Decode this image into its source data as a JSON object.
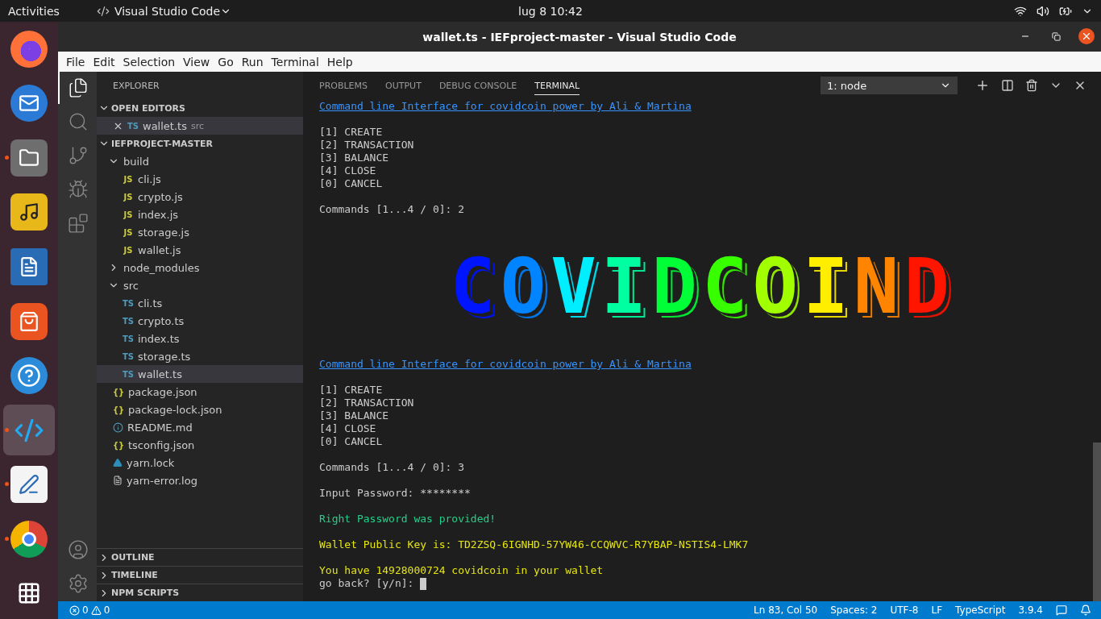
{
  "top_bar": {
    "activities": "Activities",
    "app_menu": "Visual Studio Code",
    "clock": "lug 8  10:42"
  },
  "dock": [
    {
      "kind": "firefox",
      "running": false,
      "selected": false
    },
    {
      "kind": "mail",
      "running": false,
      "selected": false
    },
    {
      "kind": "files",
      "running": true,
      "selected": false
    },
    {
      "kind": "music",
      "running": false,
      "selected": false
    },
    {
      "kind": "writer",
      "running": false,
      "selected": false
    },
    {
      "kind": "store",
      "running": false,
      "selected": false
    },
    {
      "kind": "help",
      "running": false,
      "selected": false
    },
    {
      "kind": "vscode",
      "running": true,
      "selected": true
    },
    {
      "kind": "editor",
      "running": true,
      "selected": false
    },
    {
      "kind": "chrome",
      "running": true,
      "selected": false
    },
    {
      "kind": "apps",
      "running": false,
      "selected": false
    }
  ],
  "window": {
    "title": "wallet.ts - IEFproject-master - Visual Studio Code"
  },
  "menu": [
    "File",
    "Edit",
    "Selection",
    "View",
    "Go",
    "Run",
    "Terminal",
    "Help"
  ],
  "activity_bar": [
    {
      "kind": "files",
      "selected": true
    },
    {
      "kind": "search",
      "selected": false
    },
    {
      "kind": "git",
      "selected": false
    },
    {
      "kind": "debug",
      "selected": false
    },
    {
      "kind": "extensions",
      "selected": false
    }
  ],
  "sidebar": {
    "title": "EXPLORER",
    "open_editors": {
      "title": "OPEN EDITORS",
      "expanded": true,
      "items": [
        {
          "name": "wallet.ts",
          "folder": "src",
          "kind": "ts",
          "badge": "TS",
          "selected": true
        }
      ]
    },
    "project": {
      "title": "IEFPROJECT-MASTER",
      "expanded": true,
      "items": [
        {
          "name": "build",
          "kind": "folder",
          "expanded": true,
          "selected": false,
          "children": [
            {
              "name": "cli.js",
              "kind": "js",
              "badge": "JS",
              "selected": false
            },
            {
              "name": "crypto.js",
              "kind": "js",
              "badge": "JS",
              "selected": false
            },
            {
              "name": "index.js",
              "kind": "js",
              "badge": "JS",
              "selected": false
            },
            {
              "name": "storage.js",
              "kind": "js",
              "badge": "JS",
              "selected": false
            },
            {
              "name": "wallet.js",
              "kind": "js",
              "badge": "JS",
              "selected": false
            }
          ]
        },
        {
          "name": "node_modules",
          "kind": "folder",
          "expanded": false,
          "selected": false
        },
        {
          "name": "src",
          "kind": "folder",
          "expanded": true,
          "selected": false,
          "children": [
            {
              "name": "cli.ts",
              "kind": "ts",
              "badge": "TS",
              "selected": false
            },
            {
              "name": "crypto.ts",
              "kind": "ts",
              "badge": "TS",
              "selected": false
            },
            {
              "name": "index.ts",
              "kind": "ts",
              "badge": "TS",
              "selected": false
            },
            {
              "name": "storage.ts",
              "kind": "ts",
              "badge": "TS",
              "selected": false
            },
            {
              "name": "wallet.ts",
              "kind": "ts",
              "badge": "TS",
              "selected": true
            }
          ]
        },
        {
          "name": "package.json",
          "kind": "json",
          "badge": "{}",
          "selected": false
        },
        {
          "name": "package-lock.json",
          "kind": "json",
          "badge": "{}",
          "selected": false
        },
        {
          "name": "README.md",
          "kind": "info",
          "selected": false
        },
        {
          "name": "tsconfig.json",
          "kind": "json",
          "badge": "{}",
          "selected": false
        },
        {
          "name": "yarn.lock",
          "kind": "yarn",
          "selected": false
        },
        {
          "name": "yarn-error.log",
          "kind": "log",
          "selected": false
        }
      ]
    },
    "sections": [
      {
        "title": "OUTLINE",
        "expanded": false
      },
      {
        "title": "TIMELINE",
        "expanded": false
      },
      {
        "title": "NPM SCRIPTS",
        "expanded": false
      }
    ]
  },
  "panel": {
    "tabs": [
      {
        "label": "PROBLEMS",
        "selected": false
      },
      {
        "label": "OUTPUT",
        "selected": false
      },
      {
        "label": "DEBUG CONSOLE",
        "selected": false
      },
      {
        "label": "TERMINAL",
        "selected": true
      }
    ],
    "terminal_select": "1: node",
    "terminal": [
      {
        "kind": "link",
        "text": "Command line Interface for covidcoin power by Ali & Martina"
      },
      {
        "kind": "blank"
      },
      {
        "kind": "plain",
        "text": "[1] CREATE"
      },
      {
        "kind": "plain",
        "text": "[2] TRANSACTION"
      },
      {
        "kind": "plain",
        "text": "[3] BALANCE"
      },
      {
        "kind": "plain",
        "text": "[4] CLOSE"
      },
      {
        "kind": "plain",
        "text": "[0] CANCEL"
      },
      {
        "kind": "blank"
      },
      {
        "kind": "plain",
        "text": "Commands [1...4 / 0]: 2"
      },
      {
        "kind": "banner",
        "text": "COVIDCOIND"
      },
      {
        "kind": "link",
        "text": "Command line Interface for covidcoin power by Ali & Martina"
      },
      {
        "kind": "blank"
      },
      {
        "kind": "plain",
        "text": "[1] CREATE"
      },
      {
        "kind": "plain",
        "text": "[2] TRANSACTION"
      },
      {
        "kind": "plain",
        "text": "[3] BALANCE"
      },
      {
        "kind": "plain",
        "text": "[4] CLOSE"
      },
      {
        "kind": "plain",
        "text": "[0] CANCEL"
      },
      {
        "kind": "blank"
      },
      {
        "kind": "plain",
        "text": "Commands [1...4 / 0]: 3"
      },
      {
        "kind": "blank"
      },
      {
        "kind": "plain",
        "text": "Input Password: ********"
      },
      {
        "kind": "blank"
      },
      {
        "kind": "green",
        "text": "Right Password was provided!"
      },
      {
        "kind": "blank"
      },
      {
        "kind": "yellow",
        "text": "Wallet Public Key is: TD2ZSQ-6IGNHD-57YW46-CCQWVC-R7YBAP-NSTIS4-LMK7"
      },
      {
        "kind": "blank"
      },
      {
        "kind": "yellow",
        "text": "You have 14928000724 covidcoin in your wallet"
      },
      {
        "kind": "prompt",
        "text": "go back? [y/n]:"
      }
    ]
  },
  "status_bar": {
    "errors": "0",
    "warnings": "0",
    "items": [
      "Ln 83, Col 50",
      "Spaces: 2",
      "UTF-8",
      "LF",
      "TypeScript",
      "3.9.4"
    ]
  }
}
